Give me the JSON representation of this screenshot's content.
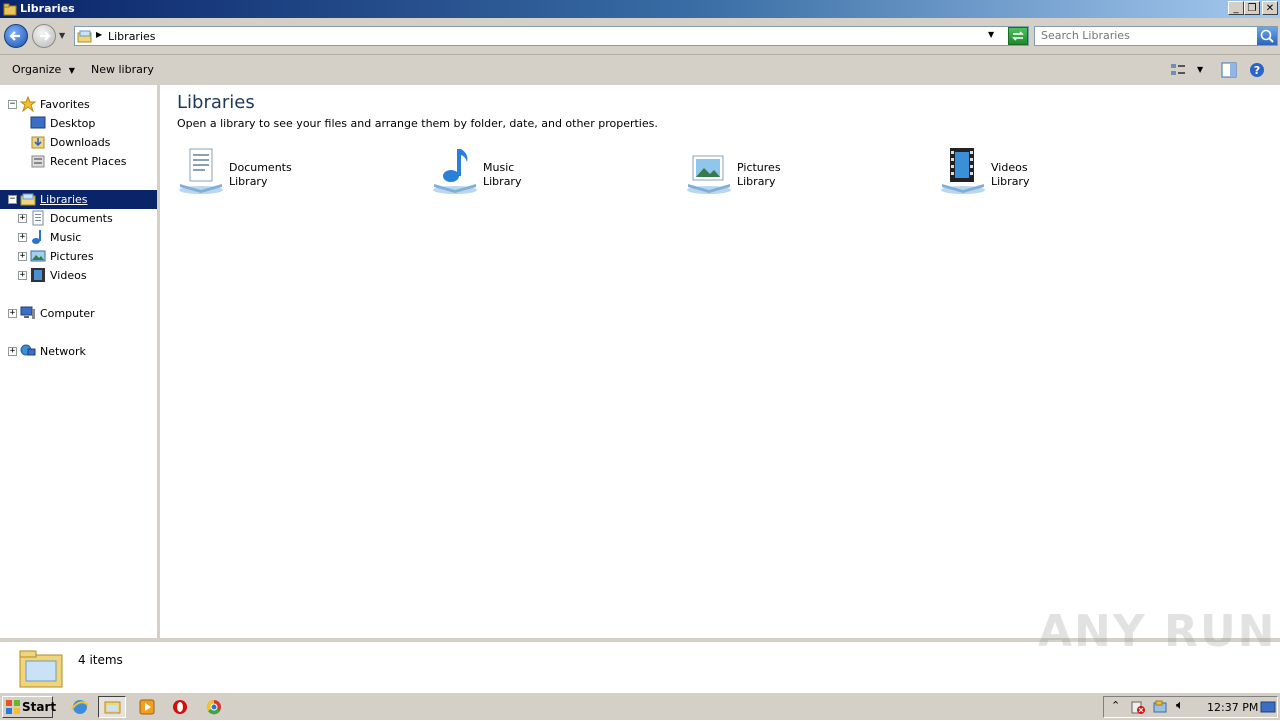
{
  "window": {
    "title": "Libraries",
    "controls": [
      "minimize",
      "restore",
      "close"
    ]
  },
  "address": {
    "path": "Libraries",
    "search_placeholder": "Search Libraries"
  },
  "commands": {
    "organize": "Organize",
    "new_library": "New library"
  },
  "nav": {
    "favorites": {
      "label": "Favorites",
      "items": [
        "Desktop",
        "Downloads",
        "Recent Places"
      ]
    },
    "libraries": {
      "label": "Libraries",
      "items": [
        "Documents",
        "Music",
        "Pictures",
        "Videos"
      ]
    },
    "computer": "Computer",
    "network": "Network"
  },
  "main": {
    "heading": "Libraries",
    "description": "Open a library to see your files and arrange them by folder, date, and other properties.",
    "items": [
      {
        "name": "Documents",
        "type": "Library",
        "icon": "documents-library-icon"
      },
      {
        "name": "Music",
        "type": "Library",
        "icon": "music-library-icon"
      },
      {
        "name": "Pictures",
        "type": "Library",
        "icon": "pictures-library-icon"
      },
      {
        "name": "Videos",
        "type": "Library",
        "icon": "videos-library-icon"
      }
    ]
  },
  "details": {
    "count": "4 items"
  },
  "taskbar": {
    "start": "Start",
    "apps": [
      "internet-explorer-icon",
      "explorer-icon",
      "media-player-icon",
      "opera-icon",
      "chrome-icon"
    ],
    "clock": "12:37 PM"
  },
  "watermark": "ANY RUN",
  "colors": {
    "selection": "#0a246a",
    "link": "#ffffff"
  }
}
